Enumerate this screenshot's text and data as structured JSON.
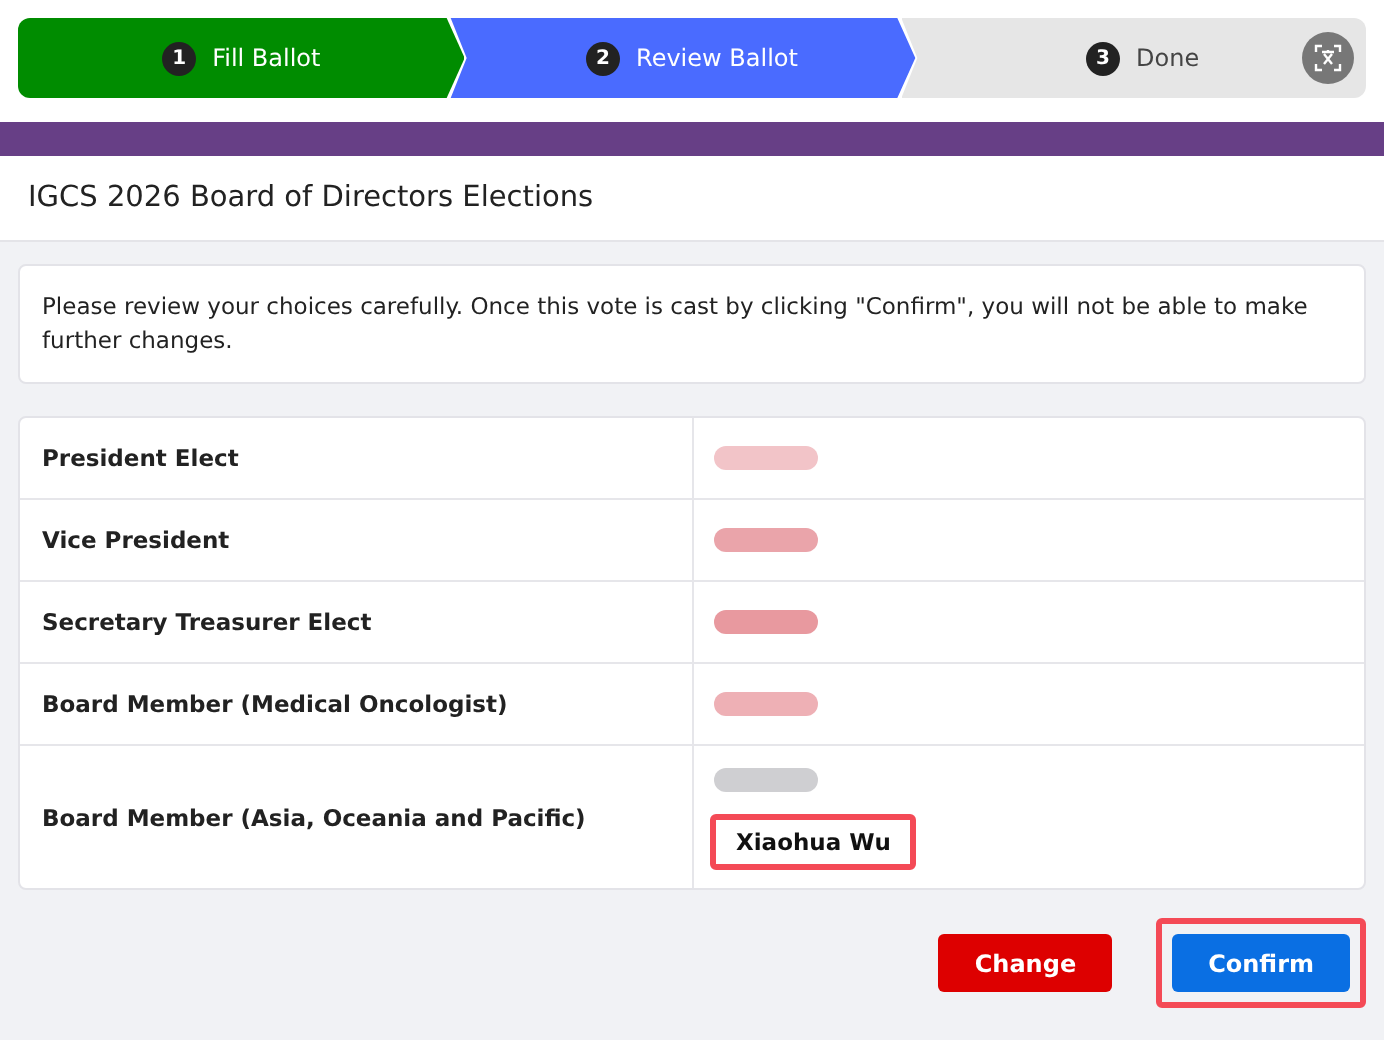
{
  "steps": [
    {
      "number": "1",
      "label": "Fill Ballot",
      "kind": "completed"
    },
    {
      "number": "2",
      "label": "Review Ballot",
      "kind": "current"
    },
    {
      "number": "3",
      "label": "Done",
      "kind": "upcoming"
    }
  ],
  "title": "IGCS 2026 Board of Directors Elections",
  "notice": "Please review your choices carefully. Once this vote is cast by clicking \"Confirm\", you will not be able to make further changes.",
  "rows": [
    {
      "position": "President Elect",
      "choices": [
        {
          "kind": "redacted",
          "color": "#f2c4c8"
        }
      ]
    },
    {
      "position": "Vice President",
      "choices": [
        {
          "kind": "redacted",
          "color": "#eaa4aa"
        }
      ]
    },
    {
      "position": "Secretary Treasurer Elect",
      "choices": [
        {
          "kind": "redacted",
          "color": "#e8999f"
        }
      ]
    },
    {
      "position": "Board Member (Medical Oncologist)",
      "choices": [
        {
          "kind": "redacted",
          "color": "#eeb0b5"
        }
      ]
    },
    {
      "position": "Board Member (Asia, Oceania and Pacific)",
      "choices": [
        {
          "kind": "redacted",
          "color": "#cfcfd2"
        },
        {
          "kind": "name",
          "name": "Xiaohua Wu",
          "highlighted": true
        }
      ]
    }
  ],
  "buttons": [
    {
      "label": "Change",
      "kind": "change",
      "highlighted": false
    },
    {
      "label": "Confirm",
      "kind": "confirm",
      "highlighted": true
    }
  ]
}
